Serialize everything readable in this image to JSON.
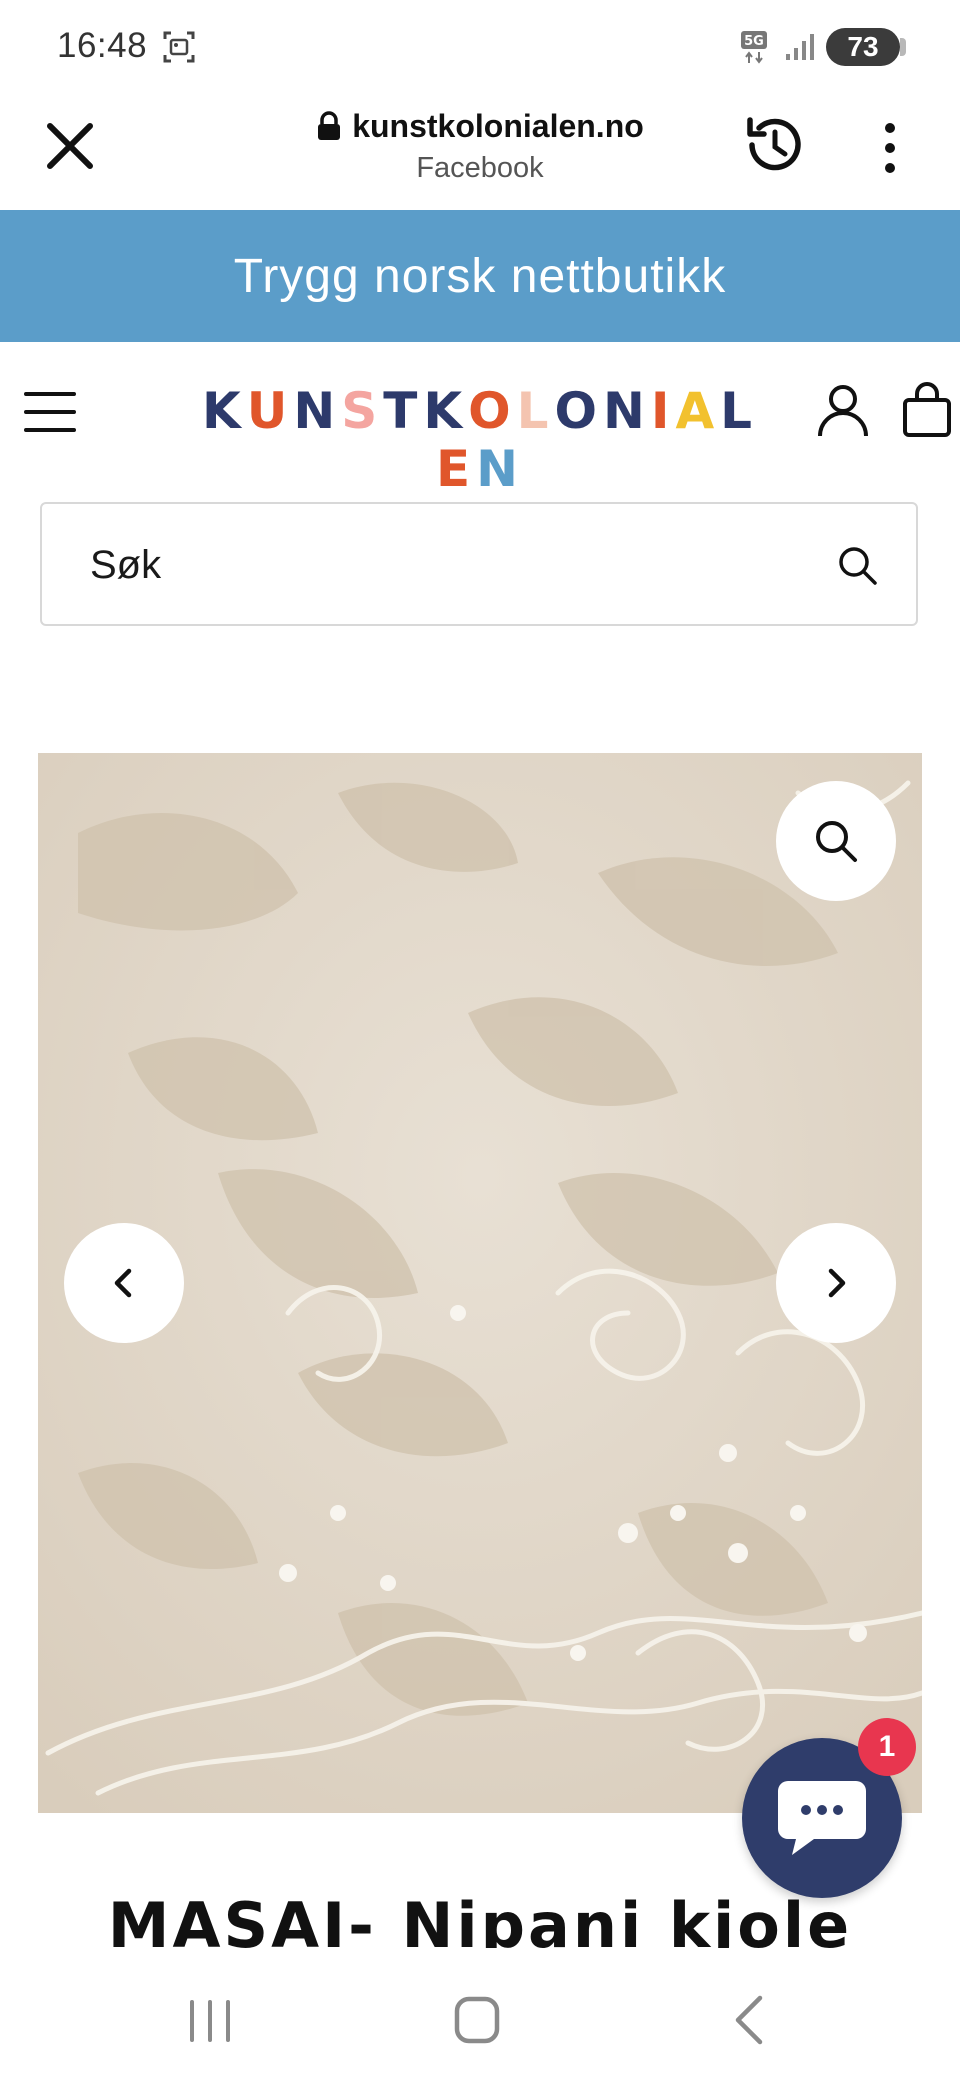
{
  "status_bar": {
    "time": "16:48",
    "network": "5G",
    "battery": "73"
  },
  "browser": {
    "url": "kunstkolonialen.no",
    "referrer": "Facebook"
  },
  "promo": {
    "text": "Trygg norsk nettbutikk",
    "background": "#5b9dc9"
  },
  "header": {
    "logo_letters": [
      {
        "ch": "K",
        "color": "#2d3a6b"
      },
      {
        "ch": "U",
        "color": "#e0562b"
      },
      {
        "ch": "N",
        "color": "#2d3a6b"
      },
      {
        "ch": "S",
        "color": "#f4a5a0"
      },
      {
        "ch": "T",
        "color": "#2d3a6b"
      },
      {
        "ch": "K",
        "color": "#2d3a6b"
      },
      {
        "ch": "O",
        "color": "#e0562b"
      },
      {
        "ch": "L",
        "color": "#f4c4b0"
      },
      {
        "ch": "O",
        "color": "#2d3a6b"
      },
      {
        "ch": "N",
        "color": "#2d3a6b"
      },
      {
        "ch": "I",
        "color": "#e0562b"
      },
      {
        "ch": "A",
        "color": "#f2c12e"
      },
      {
        "ch": "L",
        "color": "#2d3a6b"
      },
      {
        "ch": "E",
        "color": "#e0562b"
      },
      {
        "ch": "N",
        "color": "#5b9dc9"
      }
    ]
  },
  "search": {
    "placeholder": "Søk"
  },
  "product": {
    "title": "MASAI- Nipani kjole"
  },
  "chat": {
    "badge_count": "1",
    "color": "#2f3d6b"
  },
  "icons": {
    "close": "close-icon",
    "lock": "lock-icon",
    "history": "history-icon",
    "more": "more-vert-icon",
    "menu": "hamburger-icon",
    "account": "user-icon",
    "cart": "bag-icon",
    "search": "search-icon",
    "zoom": "zoom-icon",
    "prev": "chevron-left-icon",
    "next": "chevron-right-icon",
    "chat": "chat-bubble-icon"
  }
}
